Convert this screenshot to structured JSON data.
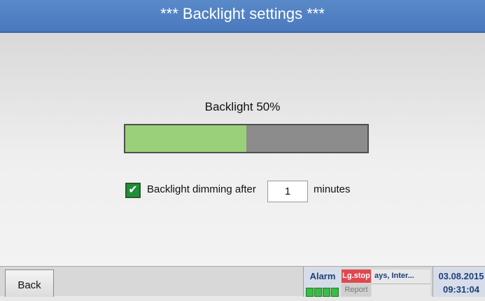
{
  "header": {
    "title": "***   Backlight settings   ***"
  },
  "main": {
    "backlight_label": "Backlight 50%",
    "backlight_level": 0.5,
    "dimming": {
      "checked": true,
      "check_glyph": "✔",
      "label": "Backlight dimming after",
      "value": "1",
      "unit": "minutes"
    }
  },
  "footer": {
    "back_label": "Back",
    "alarm_label": "Alarm",
    "lg_stop_label": "Lg.stop",
    "report_label": "Report",
    "info_text": "ays, Inter...",
    "date": "03.08.2015",
    "time": "09:31:04"
  },
  "colors": {
    "header": "#4a79bd",
    "bar_fill": "#9ad07a",
    "bar_empty": "#8c8c8c",
    "checkbox": "#1f8f3a",
    "lg_stop": "#e0474f",
    "status_text": "#1f3f7a",
    "led": "#3dbb46"
  },
  "icons": {
    "checkbox": "check-icon",
    "alarm_leds": "led-indicator-icon"
  }
}
